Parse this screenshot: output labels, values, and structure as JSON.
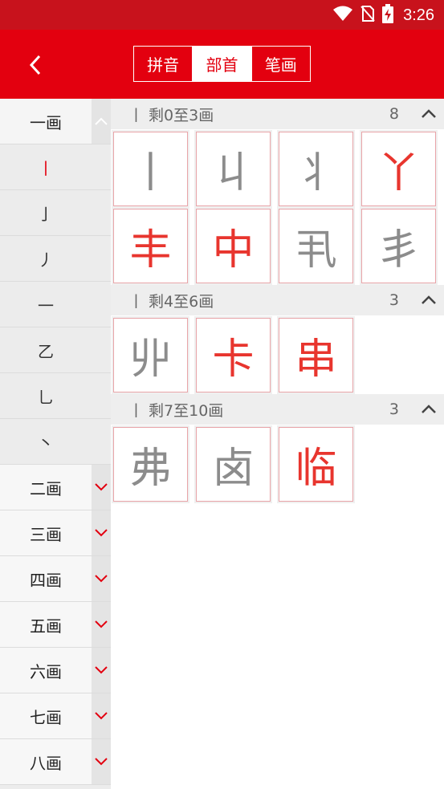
{
  "status": {
    "time": "3:26"
  },
  "tabs": [
    {
      "label": "拼音",
      "active": false
    },
    {
      "label": "部首",
      "active": true
    },
    {
      "label": "笔画",
      "active": false
    }
  ],
  "sidebar": {
    "head": "一画",
    "subs": [
      "丨",
      "亅",
      "丿",
      "一",
      "乙",
      "乚",
      "丶"
    ],
    "groups": [
      "二画",
      "三画",
      "四画",
      "五画",
      "六画",
      "七画",
      "八画"
    ]
  },
  "sections": [
    {
      "title": "丨  剩0至3画",
      "count": "8",
      "chars": [
        {
          "ch": "丨",
          "color": "gray"
        },
        {
          "ch": "丩",
          "color": "gray"
        },
        {
          "ch": "丬",
          "color": "gray"
        },
        {
          "ch": "丫",
          "color": "red"
        },
        {
          "ch": "丰",
          "color": "red"
        },
        {
          "ch": "中",
          "color": "red"
        },
        {
          "ch": "丮",
          "color": "gray"
        },
        {
          "ch": "丯",
          "color": "gray"
        }
      ]
    },
    {
      "title": "丨  剩4至6画",
      "count": "3",
      "chars": [
        {
          "ch": "丱",
          "color": "gray"
        },
        {
          "ch": "卡",
          "color": "red"
        },
        {
          "ch": "串",
          "color": "red"
        }
      ]
    },
    {
      "title": "丨  剩7至10画",
      "count": "3",
      "chars": [
        {
          "ch": "弗",
          "color": "gray"
        },
        {
          "ch": "卤",
          "color": "gray"
        },
        {
          "ch": "临",
          "color": "red"
        }
      ]
    }
  ],
  "colors": {
    "brand": "#e3000f",
    "statusbar": "#c8121c",
    "accent_char": "#e8352e",
    "muted_char": "#8c8c8c"
  }
}
